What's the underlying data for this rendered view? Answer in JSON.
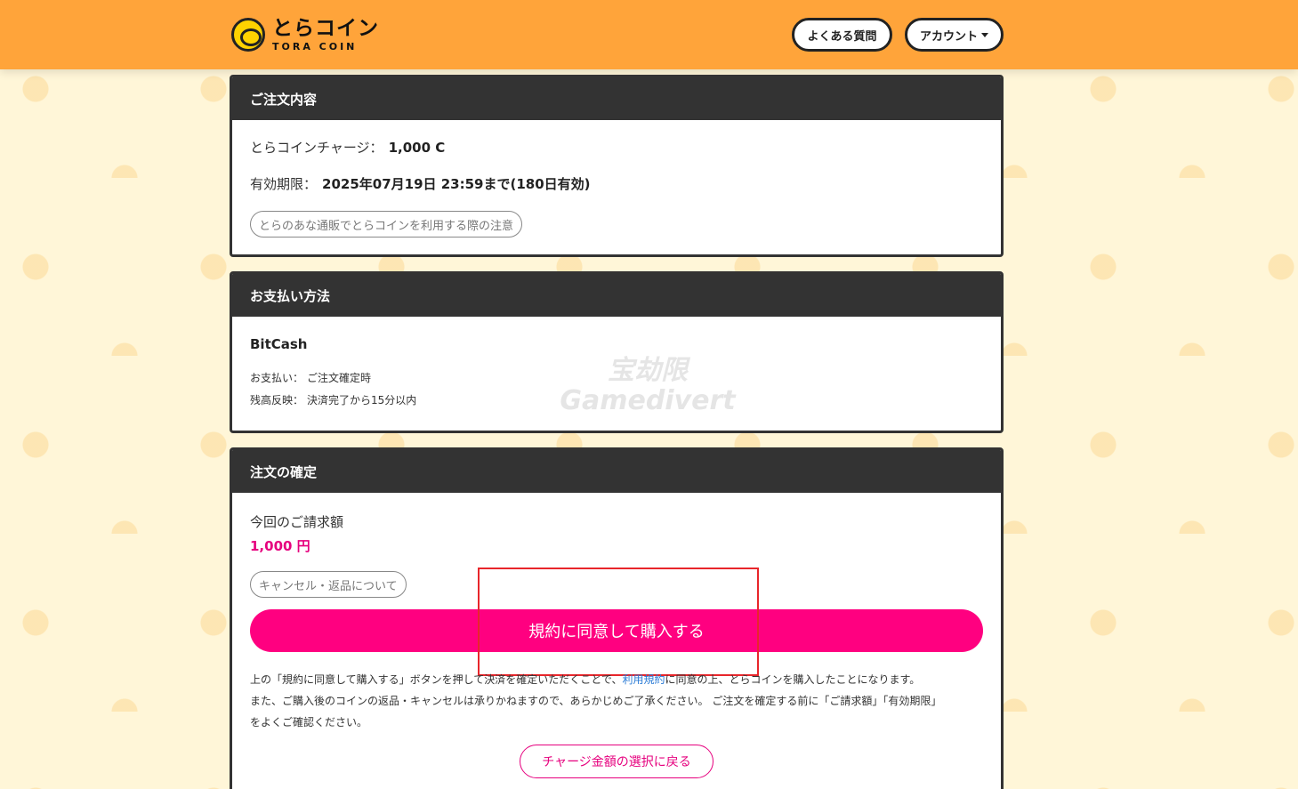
{
  "header": {
    "logo_jp": "とらコイン",
    "logo_en": "TORA COIN",
    "faq_label": "よくある質問",
    "account_label": "アカウント"
  },
  "order": {
    "title": "ご注文内容",
    "charge_label": "とらコインチャージ：",
    "charge_value": "1,000 C",
    "expiry_label": "有効期限：",
    "expiry_value": "2025年07月19日 23:59まで(180日有効)",
    "notice_link": "とらのあな通販でとらコインを利用する際の注意"
  },
  "payment": {
    "title": "お支払い方法",
    "method": "BitCash",
    "timing_label": "お支払い：",
    "timing_value": "ご注文確定時",
    "reflect_label": "残高反映：",
    "reflect_value": "決済完了から15分以内"
  },
  "confirm": {
    "title": "注文の確定",
    "charge_label": "今回のご請求額",
    "charge_amount": "1,000 円",
    "cancel_link": "キャンセル・返品について",
    "buy_button": "規約に同意して購入する",
    "note_part1": "上の「規約に同意して購入する」ボタンを押して決済を確定いただくことで、",
    "terms_link": "利用規約",
    "note_part2": "に同意の上、とらコインを購入したことになります。",
    "note_line2": "また、ご購入後のコインの返品・キャンセルは承りかねますので、あらかじめご了承ください。 ご注文を確定する前に「ご請求額」「有効期限」",
    "note_line3": "をよくご確認ください。",
    "back_button": "チャージ金額の選択に戻る"
  },
  "watermark": {
    "line1": "宝劫限",
    "line2": "Gamedivert"
  },
  "colors": {
    "header_bg": "#ffa43a",
    "accent_pink": "#ff0080",
    "card_header": "#333333",
    "highlight": "#e8262b"
  }
}
